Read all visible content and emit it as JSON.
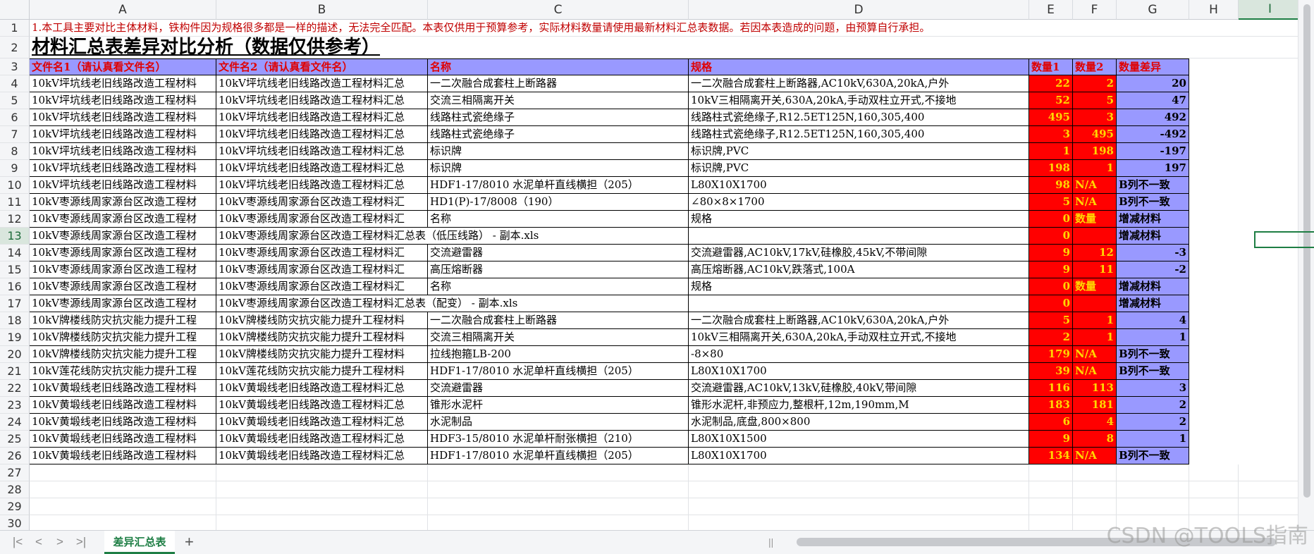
{
  "columns": [
    "A",
    "B",
    "C",
    "D",
    "E",
    "F",
    "G",
    "H",
    "I"
  ],
  "selected_column": "I",
  "selected_row": "13",
  "row_numbers": [
    "1",
    "2",
    "3",
    "4",
    "5",
    "6",
    "7",
    "8",
    "9",
    "10",
    "11",
    "12",
    "13",
    "14",
    "15",
    "16",
    "17",
    "18",
    "19",
    "20",
    "21",
    "22",
    "23",
    "24",
    "25",
    "26",
    "27",
    "28",
    "29",
    "30"
  ],
  "note": "1.本工具主要对比主体材料，铁构件因为规格很多都是一样的描述，无法完全匹配。本表仅供用于预算参考，实际材料数量请使用最新材料汇总表数据。若因本表造成的问题，由预算自行承担。",
  "title": "材料汇总表差异对比分析（数据仅供参考）",
  "headers": [
    "文件名1（请认真看文件名）",
    "文件名2（请认真看文件名）",
    "名称",
    "规格",
    "数量1",
    "数量2",
    "数量差异"
  ],
  "colors": {
    "header_bg": "#9999ff",
    "header_text": "#e00000",
    "qty_bg": "#ff0000",
    "qty_text": "#ffd700",
    "diff_bg": "#9999ff",
    "accent": "#1e7e44"
  },
  "rows": [
    {
      "a": "10kV坪坑线老旧线路改造工程材料",
      "b": "10kV坪坑线老旧线路改造工程材料汇总",
      "c": "一二次融合成套柱上断路器",
      "d": "一二次融合成套柱上断路器,AC10kV,630A,20kA,户外",
      "e": "22",
      "f": "2",
      "g": "20"
    },
    {
      "a": "10kV坪坑线老旧线路改造工程材料",
      "b": "10kV坪坑线老旧线路改造工程材料汇总",
      "c": "交流三相隔离开关",
      "d": "10kV三相隔离开关,630A,20kA,手动双柱立开式,不接地",
      "e": "52",
      "f": "5",
      "g": "47"
    },
    {
      "a": "10kV坪坑线老旧线路改造工程材料",
      "b": "10kV坪坑线老旧线路改造工程材料汇总",
      "c": "线路柱式瓷绝缘子",
      "d": "线路柱式瓷绝缘子,R12.5ET125N,160,305,400",
      "e": "495",
      "f": "3",
      "g": "492"
    },
    {
      "a": "10kV坪坑线老旧线路改造工程材料",
      "b": "10kV坪坑线老旧线路改造工程材料汇总",
      "c": "线路柱式瓷绝缘子",
      "d": "线路柱式瓷绝缘子,R12.5ET125N,160,305,400",
      "e": "3",
      "f": "495",
      "g": "-492"
    },
    {
      "a": "10kV坪坑线老旧线路改造工程材料",
      "b": "10kV坪坑线老旧线路改造工程材料汇总",
      "c": "标识牌",
      "d": "标识牌,PVC",
      "e": "1",
      "f": "198",
      "g": "-197"
    },
    {
      "a": "10kV坪坑线老旧线路改造工程材料",
      "b": "10kV坪坑线老旧线路改造工程材料汇总",
      "c": "标识牌",
      "d": "标识牌,PVC",
      "e": "198",
      "f": "1",
      "g": "197"
    },
    {
      "a": "10kV坪坑线老旧线路改造工程材料",
      "b": "10kV坪坑线老旧线路改造工程材料汇总",
      "c": "HDF1-17/8010 水泥单杆直线横担（205）",
      "d": "L80X10X1700",
      "e": "98",
      "f": "N/A",
      "g": "B列不一致"
    },
    {
      "a": "10kV枣源线周家源台区改造工程材",
      "b": "10kV枣源线周家源台区改造工程材料汇",
      "c": "HD1(P)-17/8008（190）",
      "d": "∠80×8×1700",
      "e": "5",
      "f": "N/A",
      "g": "B列不一致"
    },
    {
      "a": "10kV枣源线周家源台区改造工程材",
      "b": "10kV枣源线周家源台区改造工程材料汇",
      "c": "名称",
      "d": "规格",
      "e": "0",
      "f": "数量",
      "g": "增减材料"
    },
    {
      "a": "10kV枣源线周家源台区改造工程材",
      "b": "10kV枣源线周家源台区改造工程材料汇总表（低压线路） - 副本.xls",
      "c": "",
      "d": "",
      "e": "0",
      "f": "",
      "g": "增减材料"
    },
    {
      "a": "10kV枣源线周家源台区改造工程材",
      "b": "10kV枣源线周家源台区改造工程材料汇",
      "c": "交流避雷器",
      "d": "交流避雷器,AC10kV,17kV,硅橡胶,45kV,不带间隙",
      "e": "9",
      "f": "12",
      "g": "-3"
    },
    {
      "a": "10kV枣源线周家源台区改造工程材",
      "b": "10kV枣源线周家源台区改造工程材料汇",
      "c": "高压熔断器",
      "d": "高压熔断器,AC10kV,跌落式,100A",
      "e": "9",
      "f": "11",
      "g": "-2"
    },
    {
      "a": "10kV枣源线周家源台区改造工程材",
      "b": "10kV枣源线周家源台区改造工程材料汇",
      "c": "名称",
      "d": "规格",
      "e": "0",
      "f": "数量",
      "g": "增减材料"
    },
    {
      "a": "10kV枣源线周家源台区改造工程材",
      "b": "10kV枣源线周家源台区改造工程材料汇总表（配变） - 副本.xls",
      "c": "",
      "d": "",
      "e": "0",
      "f": "",
      "g": "增减材料"
    },
    {
      "a": "10kV牌楼线防灾抗灾能力提升工程",
      "b": "10kV牌楼线防灾抗灾能力提升工程材料",
      "c": "一二次融合成套柱上断路器",
      "d": "一二次融合成套柱上断路器,AC10kV,630A,20kA,户外",
      "e": "5",
      "f": "1",
      "g": "4"
    },
    {
      "a": "10kV牌楼线防灾抗灾能力提升工程",
      "b": "10kV牌楼线防灾抗灾能力提升工程材料",
      "c": "交流三相隔离开关",
      "d": "10kV三相隔离开关,630A,20kA,手动双柱立开式,不接地",
      "e": "2",
      "f": "1",
      "g": "1"
    },
    {
      "a": "10kV牌楼线防灾抗灾能力提升工程",
      "b": "10kV牌楼线防灾抗灾能力提升工程材料",
      "c": "拉线抱箍LB-200",
      "d": "-8×80",
      "e": "179",
      "f": "N/A",
      "g": "B列不一致"
    },
    {
      "a": "10kV莲花线防灾抗灾能力提升工程",
      "b": "10kV莲花线防灾抗灾能力提升工程材料",
      "c": "HDF1-17/8010 水泥单杆直线横担（205）",
      "d": "L80X10X1700",
      "e": "39",
      "f": "N/A",
      "g": "B列不一致"
    },
    {
      "a": "10kV黄塅线老旧线路改造工程材料",
      "b": "10kV黄塅线老旧线路改造工程材料汇总",
      "c": "交流避雷器",
      "d": "交流避雷器,AC10kV,13kV,硅橡胶,40kV,带间隙",
      "e": "116",
      "f": "113",
      "g": "3"
    },
    {
      "a": "10kV黄塅线老旧线路改造工程材料",
      "b": "10kV黄塅线老旧线路改造工程材料汇总",
      "c": "锥形水泥杆",
      "d": "锥形水泥杆,非预应力,整根杆,12m,190mm,M",
      "e": "183",
      "f": "181",
      "g": "2"
    },
    {
      "a": "10kV黄塅线老旧线路改造工程材料",
      "b": "10kV黄塅线老旧线路改造工程材料汇总",
      "c": "水泥制品",
      "d": "水泥制品,底盘,800×800",
      "e": "6",
      "f": "4",
      "g": "2"
    },
    {
      "a": "10kV黄塅线老旧线路改造工程材料",
      "b": "10kV黄塅线老旧线路改造工程材料汇总",
      "c": "HDF3-15/8010 水泥单杆耐张横担（210）",
      "d": "L80X10X1500",
      "e": "9",
      "f": "8",
      "g": "1"
    },
    {
      "a": "10kV黄塅线老旧线路改造工程材料",
      "b": "10kV黄塅线老旧线路改造工程材料汇总",
      "c": "HDF1-17/8010 水泥单杆直线横担（205）",
      "d": "L80X10X1700",
      "e": "134",
      "f": "N/A",
      "g": "B列不一致"
    }
  ],
  "sheet_tab": "差异汇总表",
  "add_sheet_symbol": "+",
  "nav": {
    "first": "|<",
    "prev": "<",
    "next": ">",
    "last": ">|"
  },
  "watermark": "CSDN @TOOLS指南"
}
